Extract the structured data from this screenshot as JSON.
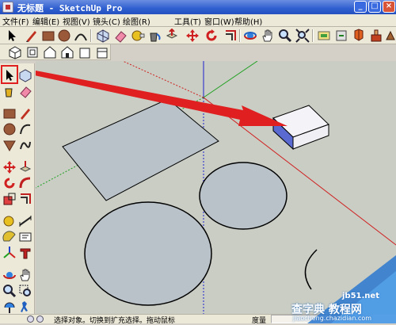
{
  "window": {
    "title": "无标题 - SketchUp Pro",
    "controls": {
      "minimize": "_",
      "maximize": "□",
      "close": "×"
    }
  },
  "menu": [
    "文件(F)",
    "编辑(E)",
    "视图(V)",
    "镜头(C)",
    "绘图(R)",
    "工具(T)",
    "窗口(W)",
    "帮助(H)"
  ],
  "toolbar_main": [
    "select-arrow-icon",
    "pencil-line-icon",
    "rectangle-icon",
    "circle-icon",
    "arc-icon",
    "make-component-icon",
    "eraser-icon",
    "tape-measure-icon",
    "paint-bucket-icon",
    "push-pull-icon",
    "move-icon",
    "rotate-icon",
    "offset-icon",
    "orbit-icon",
    "pan-hand-icon",
    "zoom-icon",
    "zoom-extents-icon",
    "3d-warehouse-icon",
    "get-models-icon",
    "share-model-icon",
    "extension-icon"
  ],
  "toolbar_views": [
    "iso-view-icon",
    "top-view-icon",
    "front-view-icon",
    "right-view-icon",
    "back-view-icon",
    "left-view-icon"
  ],
  "palette": [
    "select-arrow-icon",
    "make-component-icon",
    "paint-bucket-icon",
    "eraser-icon",
    "rectangle-icon",
    "pencil-line-icon",
    "circle-icon",
    "arc-icon",
    "polygon-icon",
    "freehand-icon",
    "move-icon",
    "push-pull-icon",
    "rotate-icon",
    "follow-me-icon",
    "scale-icon",
    "offset-icon",
    "tape-measure-icon",
    "dimension-icon",
    "protractor-icon",
    "text-icon",
    "axes-icon",
    "3d-text-icon",
    "orbit-icon",
    "pan-hand-icon",
    "zoom-icon",
    "zoom-window-icon",
    "position-camera-icon",
    "walk-icon"
  ],
  "status": {
    "message": "选择对象。切换到扩充选择。拖动鼠标",
    "measure_label": "度量"
  },
  "watermark": {
    "site": "jb51.net",
    "title": "查字典 教程网",
    "url": "jiaocheng.chazidian.com"
  },
  "colors": {
    "viewport_bg": "#c9cdc4",
    "face": "#b8c2c8",
    "arrow": "#e02020",
    "title_bar": "#2f5fd0"
  }
}
